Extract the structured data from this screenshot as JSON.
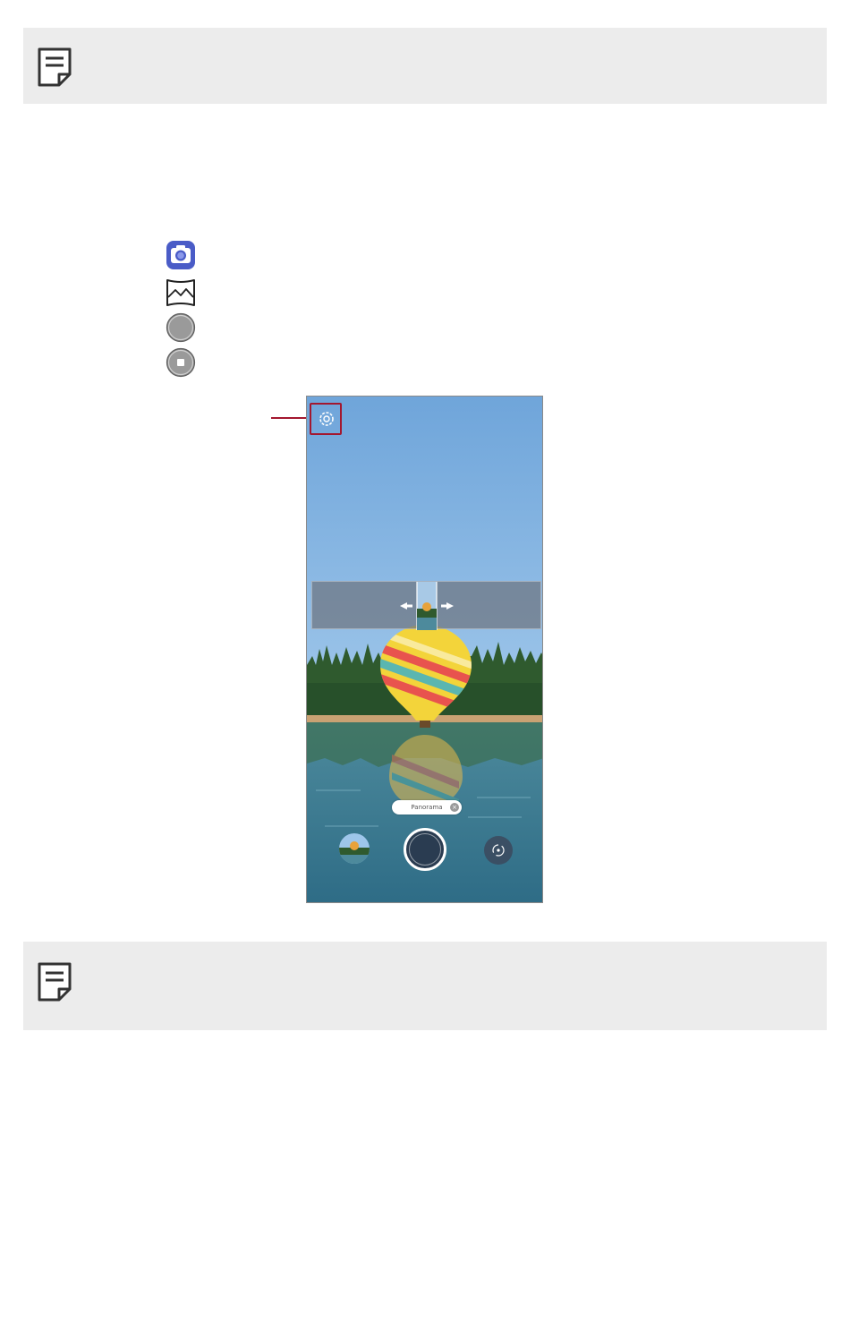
{
  "notes": [
    {
      "icon": "note-icon"
    },
    {
      "icon": "note-icon"
    }
  ],
  "steps": [
    {
      "icon": "camera-app-icon"
    },
    {
      "icon": "panorama-mode-icon"
    },
    {
      "icon": "shutter-icon"
    },
    {
      "icon": "record-icon"
    }
  ],
  "screenshot": {
    "settings_icon": "gear-icon",
    "mode_chip": {
      "label": "Panorama",
      "close_icon": "close-icon"
    },
    "bottom_bar": {
      "gallery": "gallery-thumbnail",
      "shutter": "shutter-button",
      "switch": "camera-switch-icon"
    }
  },
  "colors": {
    "accent": "#a3172f",
    "note_background": "#ececec",
    "camera_icon_blue": "#4a5cc7"
  }
}
